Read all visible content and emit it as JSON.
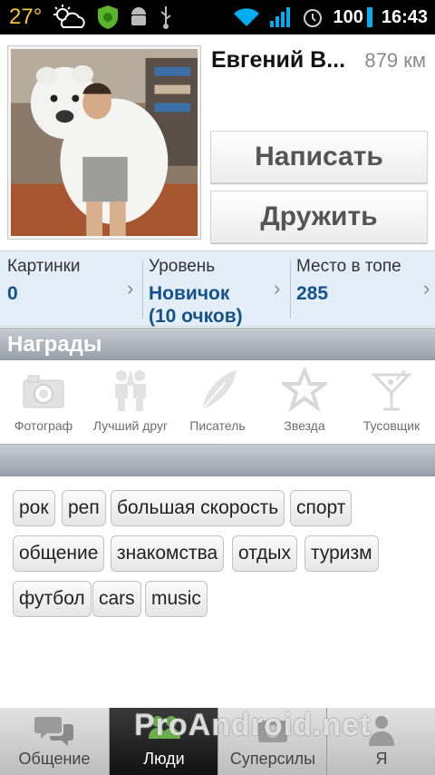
{
  "status_bar": {
    "temperature": "27°",
    "battery": "100",
    "time": "16:43",
    "icons": [
      "weather-partly-cloudy-icon",
      "shield-app-icon",
      "android-debug-icon",
      "usb-icon",
      "wifi-icon",
      "signal-icon",
      "alarm-icon",
      "battery-icon"
    ]
  },
  "profile": {
    "name": "Евгений В...",
    "distance": "879 км",
    "write_button": "Написать",
    "friend_button": "Дружить"
  },
  "stats": [
    {
      "label": "Картинки",
      "value": "0"
    },
    {
      "label": "Уровень",
      "value": "Новичок",
      "value2": "(10 очков)"
    },
    {
      "label": "Место в топе",
      "value": "285"
    }
  ],
  "awards_section": {
    "title": "Награды",
    "items": [
      {
        "label": "Фотограф",
        "icon": "camera-icon"
      },
      {
        "label": "Лучший друг",
        "icon": "best-friends-icon"
      },
      {
        "label": "Писатель",
        "icon": "feather-icon"
      },
      {
        "label": "Звезда",
        "icon": "star-icon"
      },
      {
        "label": "Тусовщик",
        "icon": "cocktail-icon"
      }
    ]
  },
  "tags": [
    "рок",
    "реп",
    "большая скорость",
    "спорт",
    "общение",
    "знакомства",
    "отдых",
    "туризм",
    "футбол",
    "cars",
    "music"
  ],
  "tabs": [
    {
      "label": "Общение",
      "icon": "chat-bubbles-icon",
      "active": false
    },
    {
      "label": "Люди",
      "icon": "people-icon",
      "active": true
    },
    {
      "label": "Суперсилы",
      "icon": "superpowers-icon",
      "active": false
    },
    {
      "label": "Я",
      "icon": "me-icon",
      "active": false
    }
  ],
  "watermark": "ProAndroid.net",
  "colors": {
    "accent_blue": "#15528a",
    "stats_background": "#e3eef9",
    "wifi": "#00aeef",
    "temperature": "#f3c534"
  }
}
